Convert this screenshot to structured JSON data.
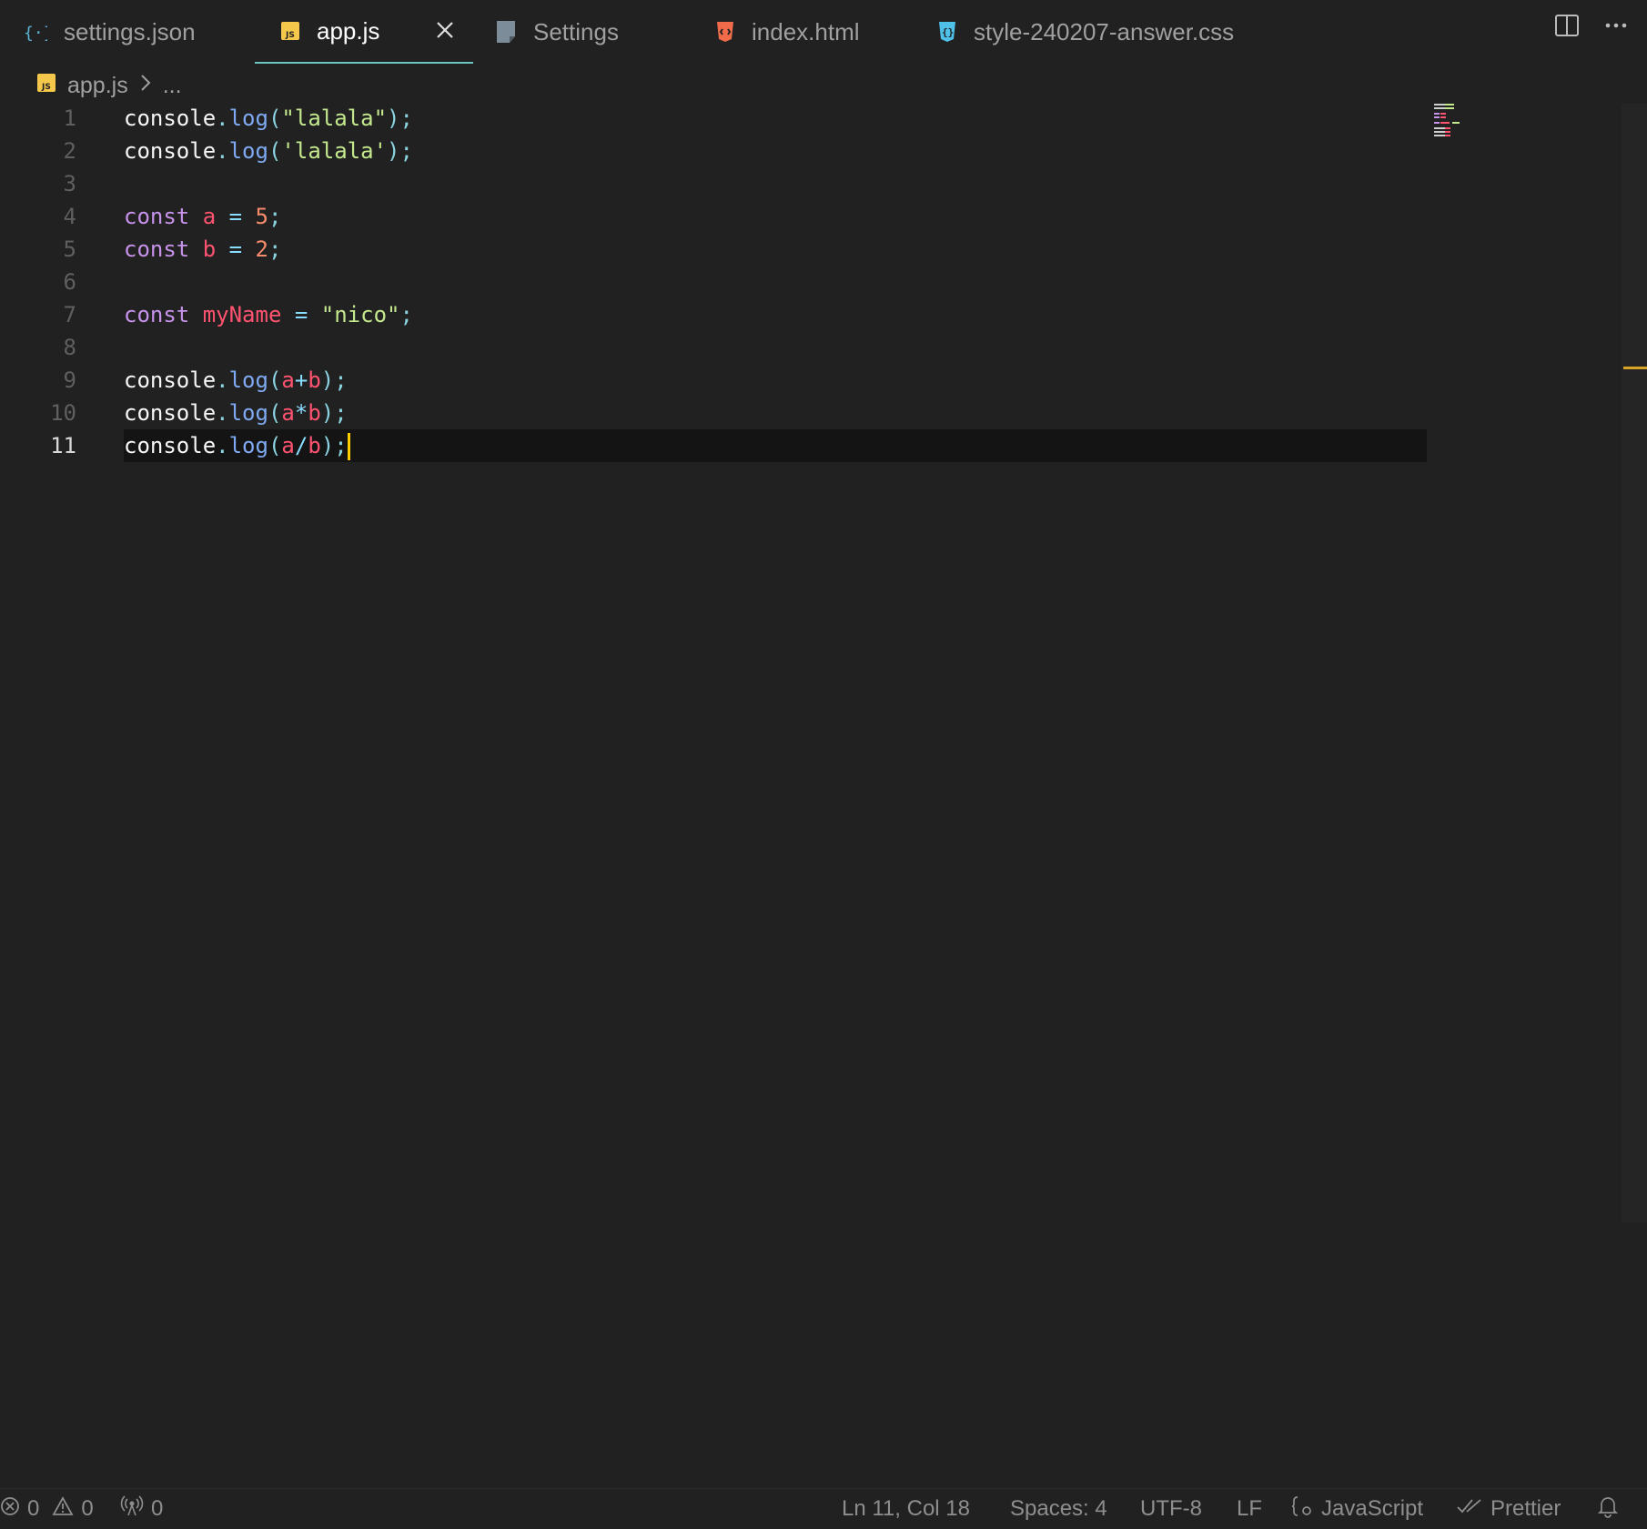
{
  "tabs": [
    {
      "label": "settings.json",
      "icon": "json-braces-icon"
    },
    {
      "label": "app.js",
      "icon": "js-file-icon",
      "active": true
    },
    {
      "label": "Settings",
      "icon": "settings-file-icon"
    },
    {
      "label": "index.html",
      "icon": "html5-icon"
    },
    {
      "label": "style-240207-answer.css",
      "icon": "css3-icon"
    }
  ],
  "breadcrumb": {
    "file": "app.js",
    "rest": "..."
  },
  "editor": {
    "lines": [
      {
        "n": "1",
        "tokens": [
          [
            "console",
            "id"
          ],
          [
            ".",
            "punc"
          ],
          [
            "log",
            "fn"
          ],
          [
            "(",
            "punc"
          ],
          [
            "\"lalala\"",
            "str"
          ],
          [
            ")",
            "punc"
          ],
          [
            ";",
            "punc"
          ]
        ]
      },
      {
        "n": "2",
        "tokens": [
          [
            "console",
            "id"
          ],
          [
            ".",
            "punc"
          ],
          [
            "log",
            "fn"
          ],
          [
            "(",
            "punc"
          ],
          [
            "'lalala'",
            "str"
          ],
          [
            ")",
            "punc"
          ],
          [
            ";",
            "punc"
          ]
        ]
      },
      {
        "n": "3",
        "tokens": []
      },
      {
        "n": "4",
        "tokens": [
          [
            "const",
            "kw"
          ],
          [
            " ",
            "id"
          ],
          [
            "a",
            "var"
          ],
          [
            " = ",
            "op"
          ],
          [
            "5",
            "num"
          ],
          [
            ";",
            "punc"
          ]
        ]
      },
      {
        "n": "5",
        "tokens": [
          [
            "const",
            "kw"
          ],
          [
            " ",
            "id"
          ],
          [
            "b",
            "var"
          ],
          [
            " = ",
            "op"
          ],
          [
            "2",
            "num"
          ],
          [
            ";",
            "punc"
          ]
        ]
      },
      {
        "n": "6",
        "tokens": []
      },
      {
        "n": "7",
        "tokens": [
          [
            "const",
            "kw"
          ],
          [
            " ",
            "id"
          ],
          [
            "myName",
            "var"
          ],
          [
            " = ",
            "op"
          ],
          [
            "\"nico\"",
            "str"
          ],
          [
            ";",
            "punc"
          ]
        ]
      },
      {
        "n": "8",
        "tokens": []
      },
      {
        "n": "9",
        "tokens": [
          [
            "console",
            "id"
          ],
          [
            ".",
            "punc"
          ],
          [
            "log",
            "fn"
          ],
          [
            "(",
            "punc"
          ],
          [
            "a",
            "var"
          ],
          [
            "+",
            "op"
          ],
          [
            "b",
            "var"
          ],
          [
            ")",
            "punc"
          ],
          [
            ";",
            "punc"
          ]
        ]
      },
      {
        "n": "10",
        "tokens": [
          [
            "console",
            "id"
          ],
          [
            ".",
            "punc"
          ],
          [
            "log",
            "fn"
          ],
          [
            "(",
            "punc"
          ],
          [
            "a",
            "var"
          ],
          [
            "*",
            "op"
          ],
          [
            "b",
            "var"
          ],
          [
            ")",
            "punc"
          ],
          [
            ";",
            "punc"
          ]
        ]
      },
      {
        "n": "11",
        "tokens": [
          [
            "console",
            "id"
          ],
          [
            ".",
            "punc"
          ],
          [
            "log",
            "fn"
          ],
          [
            "(",
            "punc"
          ],
          [
            "a",
            "var"
          ],
          [
            "/",
            "op"
          ],
          [
            "b",
            "var"
          ],
          [
            ")",
            "punc"
          ],
          [
            ";",
            "punc"
          ]
        ],
        "current": true
      }
    ]
  },
  "status": {
    "errors": "0",
    "warnings": "0",
    "ports": "0",
    "position": "Ln 11, Col 18",
    "spaces": "Spaces: 4",
    "encoding": "UTF-8",
    "eol": "LF",
    "language": "JavaScript",
    "formatter": "Prettier"
  },
  "colors": {
    "background": "#212121",
    "active_tab_underline": "#6ec6c0",
    "cursor": "#ffcc00",
    "js_badge": "#f5c84b",
    "html_icon": "#ef6b4a",
    "css_icon": "#4fc1e9"
  }
}
